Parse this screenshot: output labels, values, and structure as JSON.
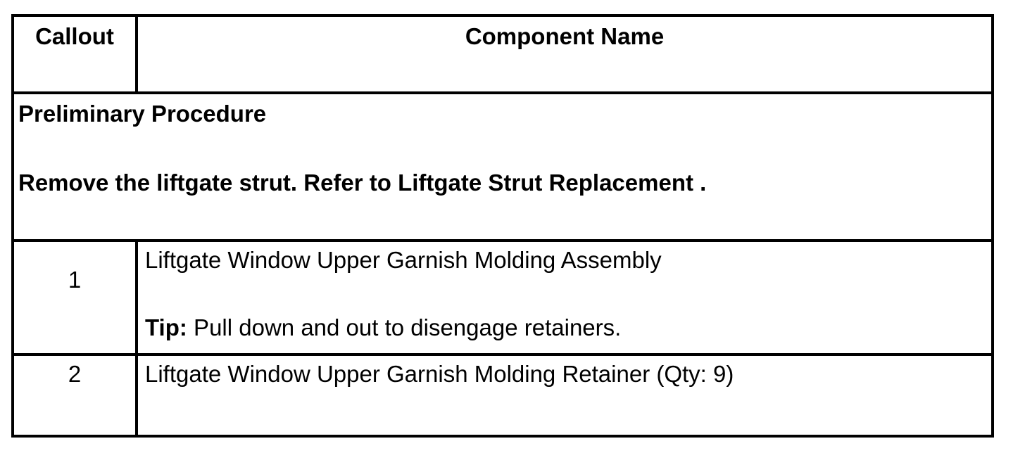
{
  "headers": {
    "callout": "Callout",
    "component_name": "Component Name"
  },
  "preliminary": {
    "title": "Preliminary Procedure",
    "step": "Remove the liftgate strut. Refer to Liftgate Strut Replacement ."
  },
  "rows": [
    {
      "callout": "1",
      "name": "Liftgate Window Upper Garnish Molding Assembly",
      "tip_label": "Tip:",
      "tip_text": " Pull down and out to disengage retainers."
    },
    {
      "callout": "2",
      "name": "Liftgate Window Upper Garnish Molding Retainer (Qty: 9)"
    }
  ]
}
